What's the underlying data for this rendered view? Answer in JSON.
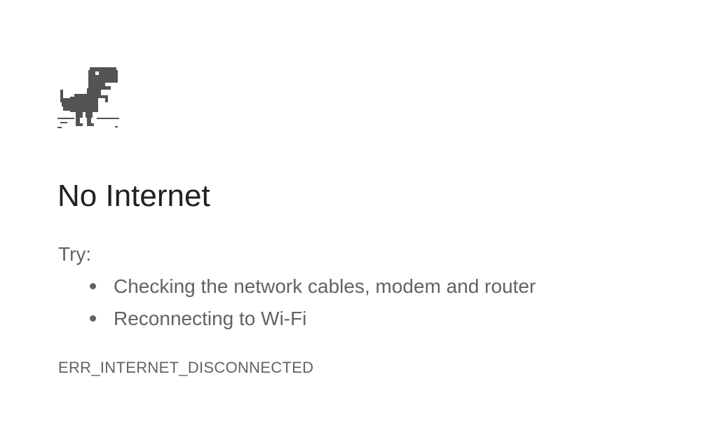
{
  "page": {
    "title": "No Internet",
    "try_label": "Try:",
    "suggestions": [
      "Checking the network cables, modem and router",
      "Reconnecting to Wi-Fi"
    ],
    "error_code": "ERR_INTERNET_DISCONNECTED"
  },
  "icons": {
    "offline": "dinosaur-icon"
  },
  "colors": {
    "title": "#202124",
    "secondary_text": "#5f6368",
    "dino": "#535353",
    "background": "#ffffff"
  }
}
